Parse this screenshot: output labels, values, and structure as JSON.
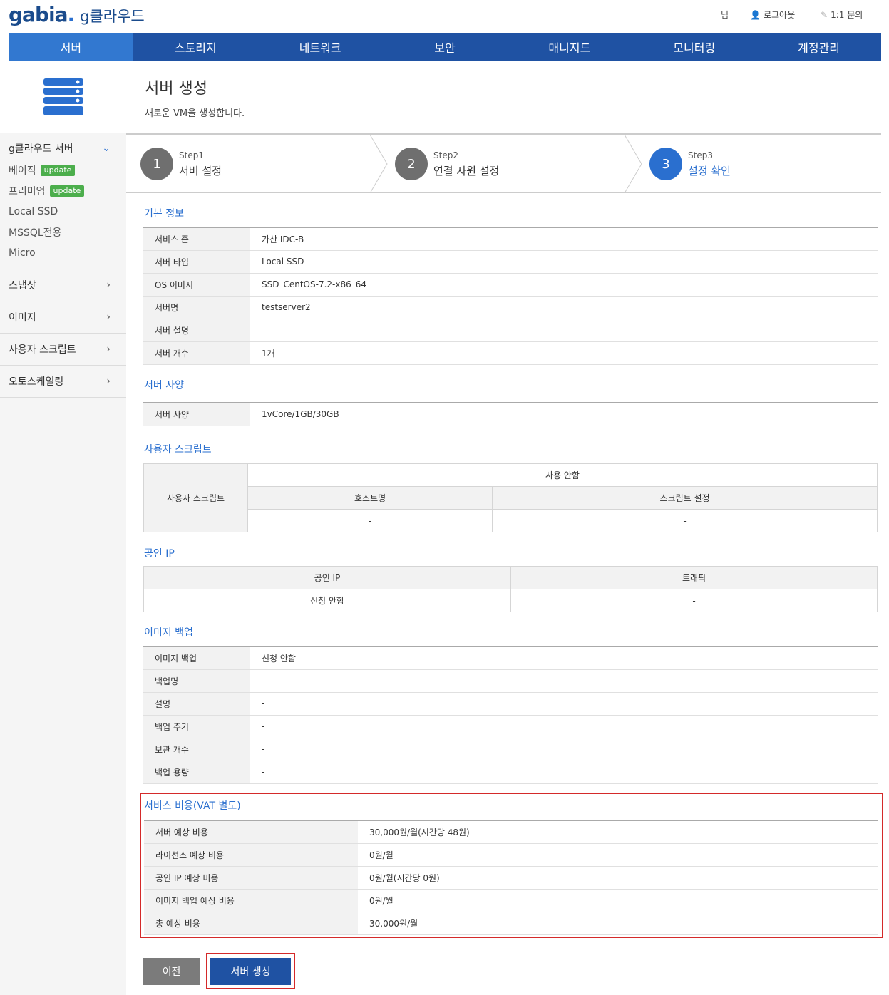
{
  "header": {
    "logo_main": "gabia",
    "logo_dot": ".",
    "logo_product": "g클라우드",
    "user_suffix": "님",
    "logout": "로그아웃",
    "inquiry": "1:1 문의"
  },
  "nav": [
    "서버",
    "스토리지",
    "네트워크",
    "보안",
    "매니지드",
    "모니터링",
    "계정관리"
  ],
  "sidebar": {
    "group_main": "g클라우드 서버",
    "subs": [
      {
        "label": "베이직",
        "badge": "update"
      },
      {
        "label": "프리미엄",
        "badge": "update"
      },
      {
        "label": "Local SSD",
        "badge": ""
      },
      {
        "label": "MSSQL전용",
        "badge": ""
      },
      {
        "label": "Micro",
        "badge": ""
      }
    ],
    "groups": [
      "스냅샷",
      "이미지",
      "사용자 스크립트",
      "오토스케일링"
    ]
  },
  "page": {
    "title": "서버 생성",
    "subtitle": "새로운 VM을 생성합니다."
  },
  "steps": [
    {
      "num": "1",
      "label": "Step1",
      "name": "서버 설정"
    },
    {
      "num": "2",
      "label": "Step2",
      "name": "연결 자원 설정"
    },
    {
      "num": "3",
      "label": "Step3",
      "name": "설정 확인"
    }
  ],
  "basic": {
    "title": "기본 정보",
    "rows": [
      {
        "k": "서비스 존",
        "v": "가산 IDC-B"
      },
      {
        "k": "서버 타입",
        "v": "Local SSD"
      },
      {
        "k": "OS 이미지",
        "v": "SSD_CentOS-7.2-x86_64"
      },
      {
        "k": "서버명",
        "v": "testserver2"
      },
      {
        "k": "서버 설명",
        "v": ""
      },
      {
        "k": "서버 개수",
        "v": "1개"
      }
    ]
  },
  "spec": {
    "title": "서버 사양",
    "k": "서버 사양",
    "v": "1vCore/1GB/30GB"
  },
  "script": {
    "title": "사용자 스크립트",
    "row_label": "사용자 스크립트",
    "status": "사용 안함",
    "col_host": "호스트명",
    "col_setting": "스크립트 설정",
    "val_host": "-",
    "val_setting": "-"
  },
  "ip": {
    "title": "공인 IP",
    "col_ip": "공인 IP",
    "col_traffic": "트래픽",
    "val_ip": "신청 안함",
    "val_traffic": "-"
  },
  "backup": {
    "title": "이미지 백업",
    "rows": [
      {
        "k": "이미지 백업",
        "v": "신청 안함"
      },
      {
        "k": "백업명",
        "v": "-"
      },
      {
        "k": "설명",
        "v": "-"
      },
      {
        "k": "백업 주기",
        "v": "-"
      },
      {
        "k": "보관 개수",
        "v": "-"
      },
      {
        "k": "백업 용량",
        "v": "-"
      }
    ]
  },
  "cost": {
    "title": "서비스 비용(VAT 별도)",
    "rows": [
      {
        "k": "서버 예상 비용",
        "v": "30,000원/월(시간당 48원)"
      },
      {
        "k": "라이선스 예상 비용",
        "v": "0원/월"
      },
      {
        "k": "공인 IP 예상 비용",
        "v": "0원/월(시간당 0원)"
      },
      {
        "k": "이미지 백업 예상 비용",
        "v": "0원/월"
      },
      {
        "k": "총 예상 비용",
        "v": "30,000원/월"
      }
    ]
  },
  "buttons": {
    "prev": "이전",
    "create": "서버 생성"
  }
}
